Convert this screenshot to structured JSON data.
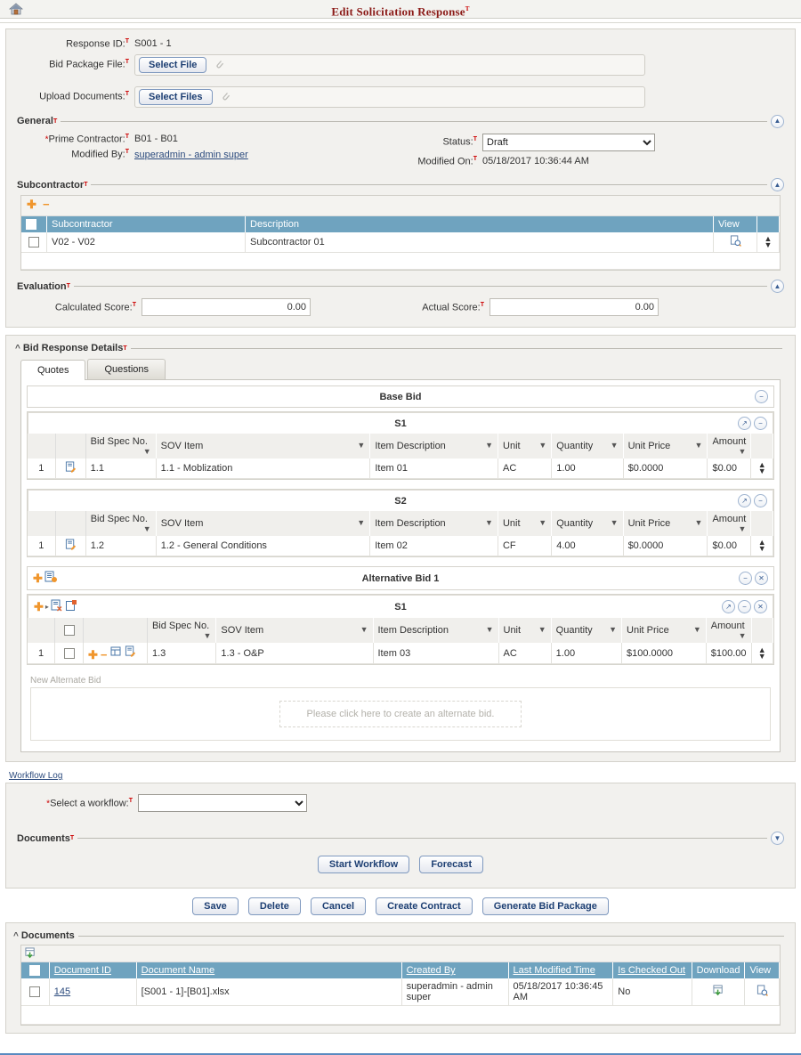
{
  "header": {
    "home_icon": "home-icon",
    "title": "Edit Solicitation Response",
    "title_sup": "T"
  },
  "top_form": {
    "response_id_label": "Response ID:",
    "response_id_value": "S001 - 1",
    "bid_package_label": "Bid Package File:",
    "select_file_button": "Select File",
    "upload_documents_label": "Upload Documents:",
    "select_files_button": "Select Files"
  },
  "general": {
    "section_title": "General",
    "prime_contractor_label": "Prime Contractor:",
    "prime_contractor_value": "B01 - B01",
    "status_label": "Status:",
    "status_value": "Draft",
    "status_options": [
      "Draft"
    ],
    "modified_by_label": "Modified By:",
    "modified_by_value": "superadmin - admin super",
    "modified_on_label": "Modified On:",
    "modified_on_value": "05/18/2017 10:36:44 AM"
  },
  "subcontractor": {
    "section_title": "Subcontractor",
    "add_icon": "add-icon",
    "remove_icon": "remove-icon",
    "columns": [
      "Subcontractor",
      "Description",
      "View"
    ],
    "rows": [
      {
        "subcontractor": "V02 - V02",
        "description": "Subcontractor 01",
        "view_icon": "view-icon"
      }
    ]
  },
  "evaluation": {
    "section_title": "Evaluation",
    "calculated_score_label": "Calculated Score:",
    "calculated_score_value": "0.00",
    "actual_score_label": "Actual Score:",
    "actual_score_value": "0.00"
  },
  "bid_response": {
    "section_title": "Bid Response Details",
    "tabs": [
      {
        "label": "Quotes",
        "active": true
      },
      {
        "label": "Questions",
        "active": false
      }
    ],
    "base_bid": {
      "title": "Base Bid",
      "groups": [
        {
          "title": "S1",
          "columns": [
            "",
            "",
            "Bid Spec No.",
            "SOV Item",
            "Item Description",
            "Unit",
            "Quantity",
            "Unit Price",
            "Amount"
          ],
          "rows": [
            {
              "num": "1",
              "row_icon": "edit-record-icon",
              "bid_spec_no": "1.1",
              "sov_item": "1.1 - Moblization",
              "item_description": "Item 01",
              "unit": "AC",
              "quantity": "1.00",
              "unit_price": "$0.0000",
              "amount": "$0.00"
            }
          ]
        },
        {
          "title": "S2",
          "columns": [
            "",
            "",
            "Bid Spec No.",
            "SOV Item",
            "Item Description",
            "Unit",
            "Quantity",
            "Unit Price",
            "Amount"
          ],
          "rows": [
            {
              "num": "1",
              "row_icon": "edit-record-icon",
              "bid_spec_no": "1.2",
              "sov_item": "1.2 - General Conditions",
              "item_description": "Item 02",
              "unit": "CF",
              "quantity": "4.00",
              "unit_price": "$0.0000",
              "amount": "$0.00"
            }
          ]
        }
      ]
    },
    "alternative_bid": {
      "title": "Alternative Bid 1",
      "group": {
        "title": "S1",
        "columns": [
          "",
          "",
          "",
          "Bid Spec No.",
          "SOV Item",
          "Item Description",
          "Unit",
          "Quantity",
          "Unit Price",
          "Amount"
        ],
        "rows": [
          {
            "num": "1",
            "bid_spec_no": "1.3",
            "sov_item": "1.3 - O&P",
            "item_description": "Item 03",
            "unit": "AC",
            "quantity": "1.00",
            "unit_price": "$100.0000",
            "amount": "$100.00"
          }
        ]
      }
    },
    "new_alternate": {
      "label": "New Alternate Bid",
      "placeholder": "Please click here to create an alternate bid."
    }
  },
  "workflow": {
    "log_link": "Workflow Log",
    "select_label": "Select a workflow:",
    "select_value": "",
    "select_options": [
      ""
    ],
    "documents_section_title": "Documents",
    "start_workflow_button": "Start Workflow",
    "forecast_button": "Forecast"
  },
  "action_buttons": [
    {
      "label": "Save"
    },
    {
      "label": "Delete"
    },
    {
      "label": "Cancel"
    },
    {
      "label": "Create Contract"
    },
    {
      "label": "Generate Bid Package"
    }
  ],
  "documents": {
    "section_title": "Documents",
    "columns": [
      "Document ID",
      "Document Name",
      "Created By",
      "Last Modified Time",
      "Is Checked Out",
      "Download",
      "View"
    ],
    "rows": [
      {
        "document_id": "145",
        "document_name": "[S001 - 1]-[B01].xlsx",
        "created_by": "superadmin - admin super",
        "last_modified_time": "05/18/2017 10:36:45 AM",
        "is_checked_out": "No",
        "download_icon": "download-icon",
        "view_icon": "view-icon"
      }
    ]
  },
  "colors": {
    "title": "#8b1a17",
    "grid_header": "#6fa3bf",
    "accent_orange": "#f0962d",
    "link_blue": "#2b4a7d"
  }
}
